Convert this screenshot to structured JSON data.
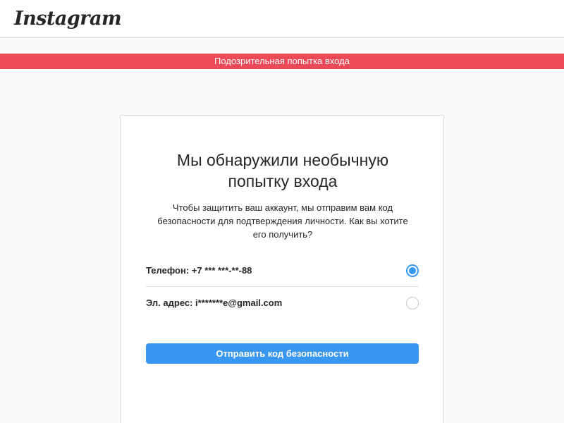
{
  "header": {
    "logo_text": "Instagram"
  },
  "banner": {
    "text": "Подозрительная попытка входа",
    "color": "#ed4956"
  },
  "card": {
    "title_line1": "Мы обнаружили необычную",
    "title_line2": "попытку входа",
    "description_line1": "Чтобы защитить ваш аккаунт, мы отправим вам код",
    "description_line2": "безопасности для подтверждения личности. Как вы хотите",
    "description_line3": "его получить?",
    "options": [
      {
        "label": "Телефон: +7 *** ***-**-88",
        "selected": true
      },
      {
        "label": "Эл. адрес: i*******e@gmail.com",
        "selected": false
      }
    ],
    "submit_label": "Отправить код безопасности"
  },
  "colors": {
    "accent": "#3897f0",
    "border": "#dbdbdb",
    "background": "#fafafa"
  }
}
